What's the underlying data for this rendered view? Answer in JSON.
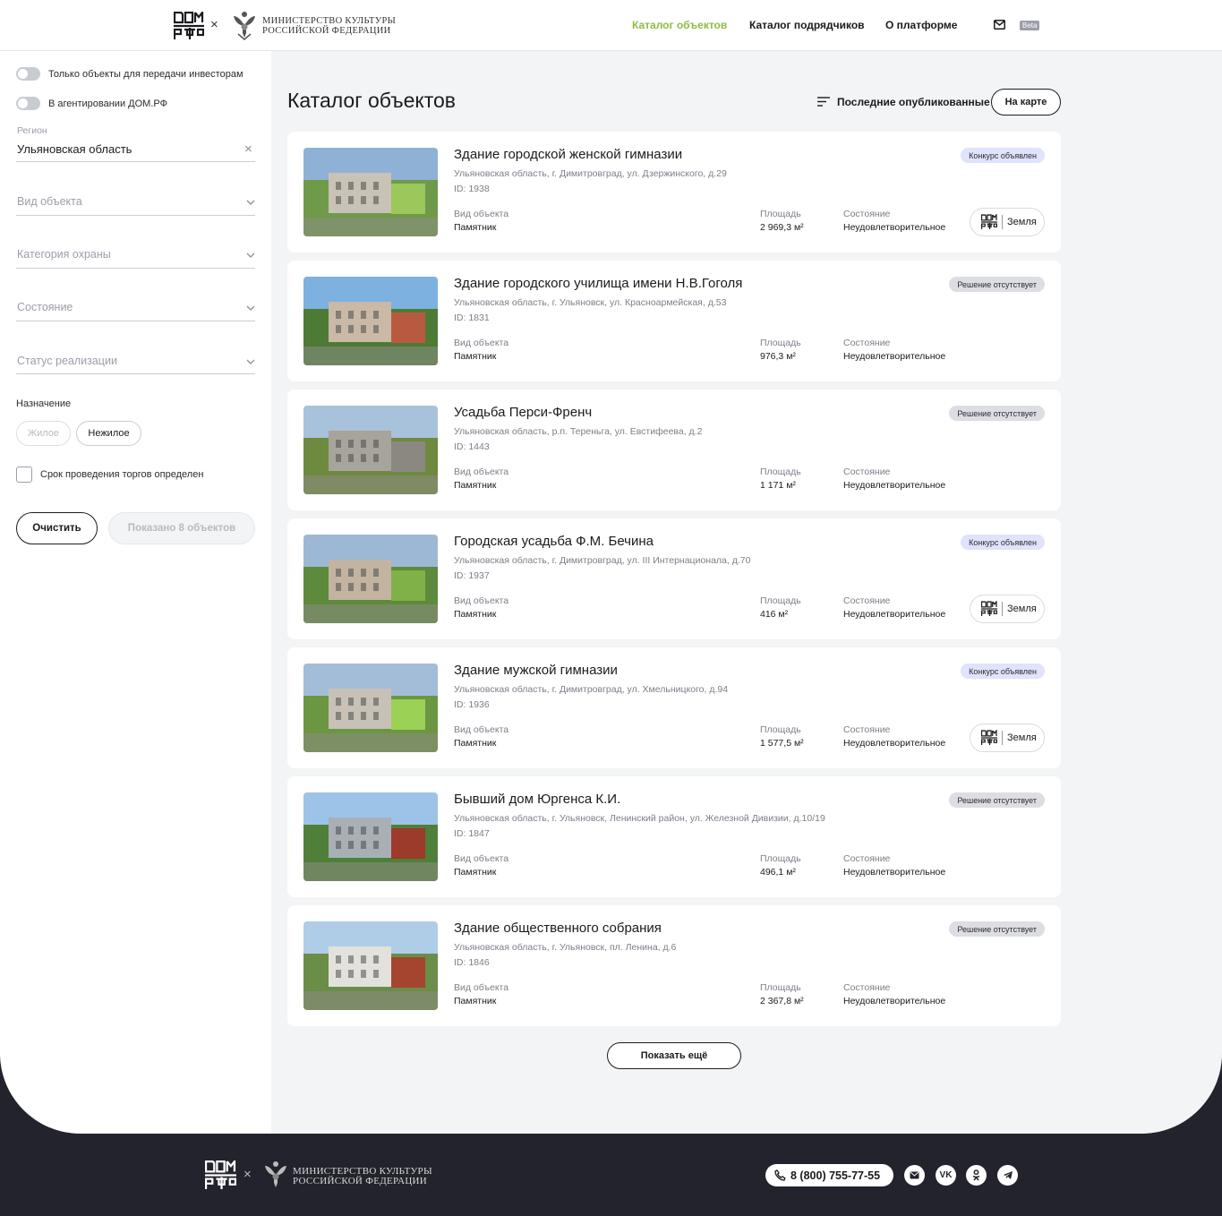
{
  "header": {
    "logo_text": "ДОМ РФ",
    "separator": "×",
    "ministry_line1": "Министерство культуры",
    "ministry_line2": "Российской Федерации",
    "nav": [
      "Каталог объектов",
      "Каталог подрядчиков",
      "О платформе"
    ],
    "beta": "Beta"
  },
  "filters": {
    "toggle_investors": "Только объекты для передачи инвесторам",
    "toggle_agent": "В агентировании ДОМ.РФ",
    "region_label": "Регион",
    "region_value": "Ульяновская область",
    "object_type": "Вид объекта",
    "protection_category": "Категория охраны",
    "condition": "Состояние",
    "sale_status": "Статус реализации",
    "purpose_title": "Назначение",
    "purpose_options": [
      "Жилое",
      "Нежилое"
    ],
    "auction_checkbox": "Срок проведения торгов определен",
    "clear_button": "Очистить",
    "shown_button": "Показано 8 объектов"
  },
  "catalog": {
    "title": "Каталог объектов",
    "sort_label": "Последние опубликованные",
    "map_button": "На карте",
    "more_button": "Показать ещё",
    "field_type": "Вид объекта",
    "field_area": "Площадь",
    "field_condition": "Состояние",
    "land_label": "Земля",
    "items": [
      {
        "title": "Здание городской женской гимназии",
        "address": "Ульяновская область, г. Димитровград, ул. Дзержинского, д.29",
        "id": "ID: 1938",
        "type": "Памятник",
        "area": "2 969,3 м²",
        "condition": "Неудовлетворительное",
        "badge": "Конкурс объявлен",
        "land": true
      },
      {
        "title": "Здание городского училища имени Н.В.Гоголя",
        "address": "Ульяновская область, г. Ульяновск, ул. Красноармейская, д.53",
        "id": "ID: 1831",
        "type": "Памятник",
        "area": "976,3 м²",
        "condition": "Неудовлетворительное",
        "badge": "Решение отсутствует",
        "land": false
      },
      {
        "title": "Усадьба Перси-Френч",
        "address": "Ульяновская область, р.п. Тереньга, ул. Евстифеева, д.2",
        "id": "ID: 1443",
        "type": "Памятник",
        "area": "1 171 м²",
        "condition": "Неудовлетворительное",
        "badge": "Решение отсутствует",
        "land": false
      },
      {
        "title": "Городская усадьба Ф.М. Бечина",
        "address": "Ульяновская область, г. Димитровград, ул. III Интернационала, д.70",
        "id": "ID: 1937",
        "type": "Памятник",
        "area": "416 м²",
        "condition": "Неудовлетворительное",
        "badge": "Конкурс объявлен",
        "land": true
      },
      {
        "title": "Здание мужской гимназии",
        "address": "Ульяновская область, г. Димитровград, ул. Хмельницкого, д.94",
        "id": "ID: 1936",
        "type": "Памятник",
        "area": "1 577,5 м²",
        "condition": "Неудовлетворительное",
        "badge": "Конкурс объявлен",
        "land": true
      },
      {
        "title": "Бывший дом Юргенса К.И.",
        "address": "Ульяновская область, г. Ульяновск, Ленинский район, ул. Железной Дивизии, д.10/19",
        "id": "ID: 1847",
        "type": "Памятник",
        "area": "496,1 м²",
        "condition": "Неудовлетворительное",
        "badge": "Решение отсутствует",
        "land": false
      },
      {
        "title": "Здание общественного собрания",
        "address": "Ульяновская область, г. Ульяновск, пл. Ленина, д.6",
        "id": "ID: 1846",
        "type": "Памятник",
        "area": "2 367,8 м²",
        "condition": "Неудовлетворительное",
        "badge": "Решение отсутствует",
        "land": false
      }
    ]
  },
  "footer": {
    "phone": "8 (800) 755-77-55",
    "socials": [
      "mail-icon",
      "vk-icon",
      "ok-icon",
      "telegram-icon"
    ]
  },
  "colors": {
    "accent": "#8ebc3f",
    "footer_bg": "#23232d",
    "badge_blue": "#dfe3fb",
    "badge_grey": "#dcdee3"
  }
}
